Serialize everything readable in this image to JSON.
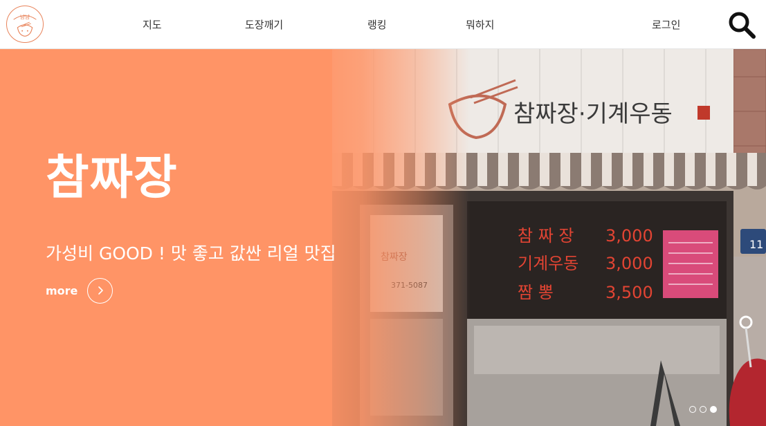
{
  "header": {
    "logo_icon": "restaurant-logo-icon",
    "nav": [
      {
        "label": "지도"
      },
      {
        "label": "도장깨기"
      },
      {
        "label": "랭킹"
      },
      {
        "label": "뭐하지"
      }
    ],
    "login_label": "로그인",
    "search_icon": "search-icon"
  },
  "hero": {
    "title": "참짜장",
    "subtitle": "가성비 GOOD ! 맛 좋고 값싼 리얼 맛집",
    "more_label": "more",
    "more_icon": "chevron-right-icon",
    "background_color": "#ff9466",
    "photo": {
      "sign_text": "참짜장·기계우동",
      "menu": [
        {
          "name": "참 짜 장",
          "price": "3,000"
        },
        {
          "name": "기계우동",
          "price": "3,000"
        },
        {
          "name": "짬    뽕",
          "price": "3,500"
        }
      ],
      "address_number": "11"
    },
    "slides": {
      "count": 3,
      "active_index": 2
    }
  }
}
